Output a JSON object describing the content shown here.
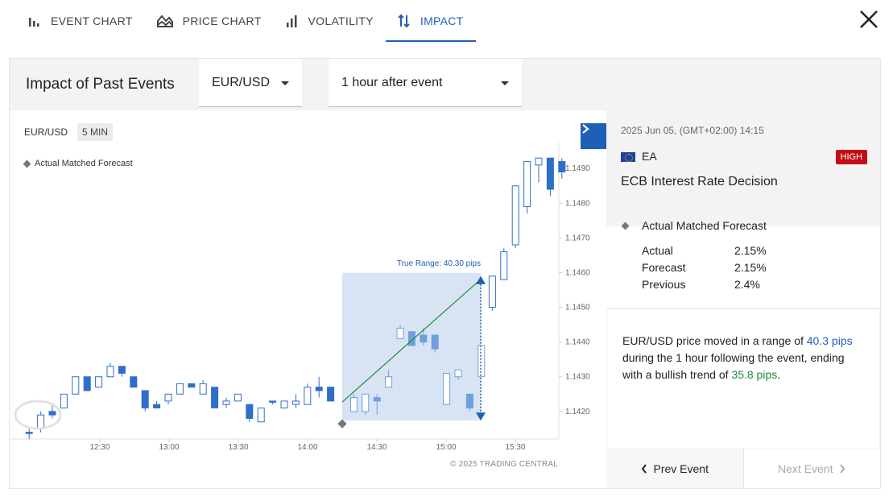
{
  "tabs": [
    {
      "label": "EVENT CHART",
      "icon": "bar-chart-icon",
      "active": false
    },
    {
      "label": "PRICE CHART",
      "icon": "mountain-chart-icon",
      "active": false
    },
    {
      "label": "VOLATILITY",
      "icon": "volatility-icon",
      "active": false
    },
    {
      "label": "IMPACT",
      "icon": "up-down-arrows-icon",
      "active": true
    }
  ],
  "panel": {
    "title": "Impact of Past Events",
    "pair_select": "EUR/USD",
    "window_select": "1 hour after event"
  },
  "chart": {
    "symbol": "EUR/USD",
    "timeframe": "5 MIN",
    "legend": "Actual Matched Forecast",
    "range_label": "True Range: 40.30 pips",
    "copyright": "© 2025 TRADING CENTRAL"
  },
  "chart_data": {
    "type": "candlestick",
    "x_ticks": [
      "12:30",
      "13:00",
      "13:30",
      "14:00",
      "14:30",
      "15:00",
      "15:30"
    ],
    "y_ticks": [
      "1.1490",
      "1.1480",
      "1.1470",
      "1.1460",
      "1.1450",
      "1.1440",
      "1.1430",
      "1.1420"
    ],
    "ylim": [
      1.1413,
      1.1497
    ],
    "event_time": "14:15",
    "true_range_pips": 40.3,
    "range_start_price": 1.1419,
    "range_end_price": 1.1459,
    "candles_before": [
      {
        "o": 1.1414,
        "h": 1.1415,
        "l": 1.1412,
        "c": 1.1414,
        "bull": false
      },
      {
        "o": 1.1415,
        "h": 1.142,
        "l": 1.1414,
        "c": 1.1419,
        "bull": true
      },
      {
        "o": 1.142,
        "h": 1.1422,
        "l": 1.1418,
        "c": 1.1419,
        "bull": false
      },
      {
        "o": 1.1421,
        "h": 1.1425,
        "l": 1.1421,
        "c": 1.1425,
        "bull": true
      },
      {
        "o": 1.1425,
        "h": 1.143,
        "l": 1.1425,
        "c": 1.143,
        "bull": true
      },
      {
        "o": 1.143,
        "h": 1.143,
        "l": 1.1426,
        "c": 1.1426,
        "bull": false
      },
      {
        "o": 1.1427,
        "h": 1.143,
        "l": 1.1427,
        "c": 1.143,
        "bull": true
      },
      {
        "o": 1.143,
        "h": 1.1434,
        "l": 1.143,
        "c": 1.1433,
        "bull": true
      },
      {
        "o": 1.1433,
        "h": 1.1433,
        "l": 1.143,
        "c": 1.1431,
        "bull": false
      },
      {
        "o": 1.143,
        "h": 1.143,
        "l": 1.1427,
        "c": 1.1427,
        "bull": false
      },
      {
        "o": 1.1426,
        "h": 1.1426,
        "l": 1.142,
        "c": 1.1421,
        "bull": false
      },
      {
        "o": 1.1421,
        "h": 1.1423,
        "l": 1.1421,
        "c": 1.1422,
        "bull": false
      },
      {
        "o": 1.1423,
        "h": 1.1425,
        "l": 1.1422,
        "c": 1.1425,
        "bull": true
      },
      {
        "o": 1.1425,
        "h": 1.1428,
        "l": 1.1425,
        "c": 1.1428,
        "bull": true
      },
      {
        "o": 1.1428,
        "h": 1.1428,
        "l": 1.1427,
        "c": 1.1427,
        "bull": false
      },
      {
        "o": 1.1425,
        "h": 1.1429,
        "l": 1.1425,
        "c": 1.1428,
        "bull": true
      },
      {
        "o": 1.1427,
        "h": 1.1427,
        "l": 1.1421,
        "c": 1.1421,
        "bull": false
      },
      {
        "o": 1.1422,
        "h": 1.1424,
        "l": 1.1421,
        "c": 1.1423,
        "bull": true
      },
      {
        "o": 1.1423,
        "h": 1.1425,
        "l": 1.1423,
        "c": 1.1425,
        "bull": true
      },
      {
        "o": 1.1422,
        "h": 1.1422,
        "l": 1.1417,
        "c": 1.1418,
        "bull": false
      },
      {
        "o": 1.1417,
        "h": 1.1421,
        "l": 1.1417,
        "c": 1.1421,
        "bull": true
      },
      {
        "o": 1.1423,
        "h": 1.1423,
        "l": 1.1422,
        "c": 1.1423,
        "bull": false
      },
      {
        "o": 1.1421,
        "h": 1.1423,
        "l": 1.1421,
        "c": 1.1423,
        "bull": true
      },
      {
        "o": 1.1422,
        "h": 1.1425,
        "l": 1.1421,
        "c": 1.1423,
        "bull": true
      },
      {
        "o": 1.1422,
        "h": 1.1428,
        "l": 1.1422,
        "c": 1.1427,
        "bull": true
      },
      {
        "o": 1.1427,
        "h": 1.143,
        "l": 1.1424,
        "c": 1.1426,
        "bull": false
      },
      {
        "o": 1.1427,
        "h": 1.1427,
        "l": 1.1423,
        "c": 1.1423,
        "bull": false
      }
    ],
    "candles_after": [
      {
        "o": 1.142,
        "h": 1.1425,
        "l": 1.142,
        "c": 1.1424,
        "bull": true
      },
      {
        "o": 1.142,
        "h": 1.1425,
        "l": 1.1419,
        "c": 1.1425,
        "bull": true
      },
      {
        "o": 1.1424,
        "h": 1.1425,
        "l": 1.1419,
        "c": 1.1423,
        "bull": false
      },
      {
        "o": 1.1427,
        "h": 1.1432,
        "l": 1.1427,
        "c": 1.143,
        "bull": true
      },
      {
        "o": 1.1441,
        "h": 1.1445,
        "l": 1.1441,
        "c": 1.1444,
        "bull": true
      },
      {
        "o": 1.1443,
        "h": 1.1443,
        "l": 1.1439,
        "c": 1.1439,
        "bull": false
      },
      {
        "o": 1.1442,
        "h": 1.1444,
        "l": 1.1439,
        "c": 1.144,
        "bull": false
      },
      {
        "o": 1.1442,
        "h": 1.1442,
        "l": 1.1437,
        "c": 1.1438,
        "bull": false
      },
      {
        "o": 1.1422,
        "h": 1.1431,
        "l": 1.1422,
        "c": 1.1431,
        "bull": true
      },
      {
        "o": 1.143,
        "h": 1.1432,
        "l": 1.1429,
        "c": 1.1432,
        "bull": true
      },
      {
        "o": 1.1425,
        "h": 1.1425,
        "l": 1.142,
        "c": 1.1421,
        "bull": false
      },
      {
        "o": 1.143,
        "h": 1.1439,
        "l": 1.143,
        "c": 1.1439,
        "bull": true
      }
    ],
    "candles_late": [
      {
        "o": 1.145,
        "h": 1.1459,
        "l": 1.1449,
        "c": 1.1459,
        "bull": true
      },
      {
        "o": 1.1458,
        "h": 1.1467,
        "l": 1.1458,
        "c": 1.1466,
        "bull": true
      },
      {
        "o": 1.1468,
        "h": 1.1485,
        "l": 1.1467,
        "c": 1.1485,
        "bull": true
      },
      {
        "o": 1.1479,
        "h": 1.1492,
        "l": 1.1477,
        "c": 1.1492,
        "bull": true
      },
      {
        "o": 1.1491,
        "h": 1.1493,
        "l": 1.1486,
        "c": 1.1493,
        "bull": true
      },
      {
        "o": 1.1493,
        "h": 1.1493,
        "l": 1.1482,
        "c": 1.1484,
        "bull": false
      },
      {
        "o": 1.1492,
        "h": 1.1493,
        "l": 1.1487,
        "c": 1.1489,
        "bull": false
      }
    ]
  },
  "event": {
    "date": "2025 Jun 05, (GMT+02:00) 14:15",
    "country": "EA",
    "impact": "HIGH",
    "name": "ECB Interest Rate Decision",
    "match_title": "Actual Matched Forecast",
    "stats": [
      {
        "label": "Actual",
        "value": "2.15%"
      },
      {
        "label": "Forecast",
        "value": "2.15%"
      },
      {
        "label": "Previous",
        "value": "2.4%"
      }
    ]
  },
  "summary": {
    "part1": "EUR/USD price moved in a range of ",
    "pips": "40.3 pips",
    "part2": " during the 1 hour following the event, ending with a bullish trend of ",
    "trend": "35.8 pips",
    "part3": "."
  },
  "nav": {
    "prev": "Prev Event",
    "next": "Next Event"
  },
  "colors": {
    "accent": "#1e5fb8",
    "high": "#c30d17",
    "bullish": "#1f8b3a"
  }
}
